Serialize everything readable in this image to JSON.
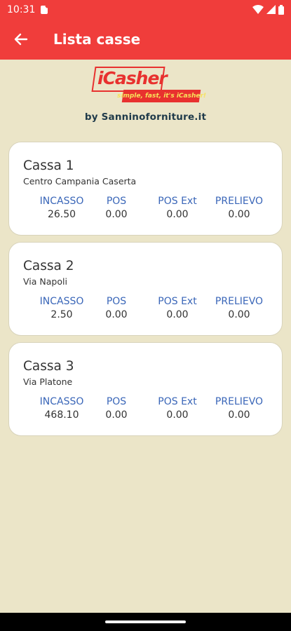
{
  "status_bar": {
    "time": "10:31",
    "icons": [
      "sd-card-icon",
      "wifi-icon",
      "signal-icon",
      "battery-icon"
    ]
  },
  "app_bar": {
    "title": "Lista casse",
    "back_icon": "arrow-left-icon"
  },
  "logo": {
    "main": "iCasher",
    "tagline": "simple, fast, it's iCasher!",
    "byline": "by Sanninoforniture.it"
  },
  "columns": [
    "INCASSO",
    "POS",
    "POS Ext",
    "PRELIEVO"
  ],
  "registers": [
    {
      "name": "Cassa 1",
      "location": "Centro Campania Caserta",
      "incasso": "26.50",
      "pos": "0.00",
      "pos_ext": "0.00",
      "prelievo": "0.00"
    },
    {
      "name": "Cassa 2",
      "location": "Via Napoli",
      "incasso": "2.50",
      "pos": "0.00",
      "pos_ext": "0.00",
      "prelievo": "0.00"
    },
    {
      "name": "Cassa 3",
      "location": "Via Platone",
      "incasso": "468.10",
      "pos": "0.00",
      "pos_ext": "0.00",
      "prelievo": "0.00"
    }
  ],
  "colors": {
    "accent": "#f03d3b",
    "background": "#ebe5c8",
    "label_blue": "#3a66b8"
  }
}
